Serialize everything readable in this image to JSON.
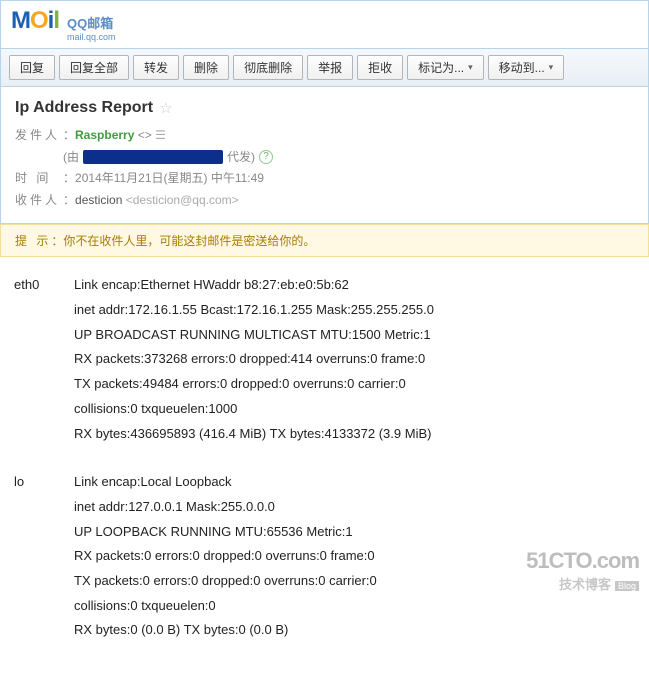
{
  "logo": {
    "m": "M",
    "o": "O",
    "i": "i",
    "l": "l",
    "qq": "QQ邮箱",
    "url": "mail.qq.com"
  },
  "toolbar": {
    "reply": "回复",
    "replyAll": "回复全部",
    "forward": "转发",
    "delete": "删除",
    "deleteForever": "彻底删除",
    "report": "举报",
    "reject": "拒收",
    "markAs": "标记为...",
    "moveTo": "移动到..."
  },
  "subject": "Ip Address Report",
  "meta": {
    "senderLabel": "发件人",
    "senderName": "Raspberry",
    "senderAddr": "<>",
    "proxyPrefix": "(由",
    "proxySuffix": "代发)",
    "timeLabel": "时 间",
    "timeValue": "2014年11月21日(星期五) 中午11:49",
    "recipientLabel": "收件人",
    "recipientName": "desticion",
    "recipientAddr": "<desticion@qq.com>"
  },
  "hint": {
    "label": "提 示",
    "text": "：你不在收件人里，可能这封邮件是密送给你的。"
  },
  "body": {
    "eth0": {
      "name": "eth0",
      "l1": "Link encap:Ethernet  HWaddr b8:27:eb:e0:5b:62",
      "l2": "inet addr:172.16.1.55  Bcast:172.16.1.255  Mask:255.255.255.0",
      "l3": "UP BROADCAST RUNNING MULTICAST  MTU:1500  Metric:1",
      "l4": "RX packets:373268 errors:0 dropped:414 overruns:0 frame:0",
      "l5": "TX packets:49484 errors:0 dropped:0 overruns:0 carrier:0",
      "l6": "collisions:0 txqueuelen:1000",
      "l7": "RX bytes:436695893 (416.4 MiB)  TX bytes:4133372 (3.9 MiB)"
    },
    "lo": {
      "name": "lo",
      "l1": "Link encap:Local Loopback",
      "l2": "inet addr:127.0.0.1  Mask:255.0.0.0",
      "l3": "UP LOOPBACK RUNNING  MTU:65536  Metric:1",
      "l4": "RX packets:0 errors:0 dropped:0 overruns:0 frame:0",
      "l5": "TX packets:0 errors:0 dropped:0 overruns:0 carrier:0",
      "l6": "collisions:0 txqueuelen:0",
      "l7": "RX bytes:0 (0.0 B)  TX bytes:0 (0.0 B)"
    }
  },
  "watermark": {
    "top": "51CTO.com",
    "bot": "技术博客",
    "blog": "Blog"
  }
}
